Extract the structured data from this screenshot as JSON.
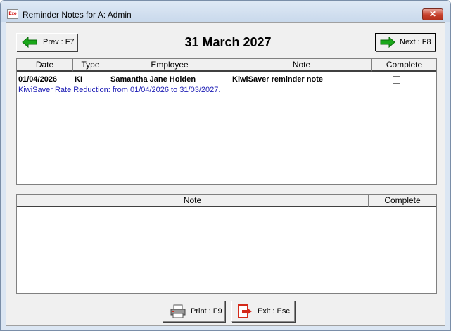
{
  "window": {
    "title": "Reminder Notes for A: Admin",
    "close_label": "✕",
    "app_icon_text": "Exo"
  },
  "header": {
    "date_title": "31 March 2027",
    "prev_label": "Prev : F7",
    "next_label": "Next : F8"
  },
  "notes_grid": {
    "columns": [
      "Date",
      "Type",
      "Employee",
      "Note",
      "Complete"
    ],
    "rows": [
      {
        "date": "01/04/2026",
        "type": "KI",
        "employee": "Samantha Jane Holden",
        "note": "KiwiSaver reminder note",
        "complete": false,
        "detail": "KiwiSaver Rate Reduction: from 01/04/2026 to 31/03/2027."
      }
    ]
  },
  "detail_grid": {
    "columns": [
      "Note",
      "Complete"
    ]
  },
  "footer": {
    "print_label": "Print : F9",
    "exit_label": "Exit : Esc"
  },
  "colors": {
    "detail_text": "#1a1ab4",
    "arrow_green": "#1aa81a",
    "exit_red": "#d42a1a"
  },
  "icons": {
    "prev": "left-arrow-icon",
    "next": "right-arrow-icon",
    "print": "printer-icon",
    "exit": "exit-door-icon"
  }
}
